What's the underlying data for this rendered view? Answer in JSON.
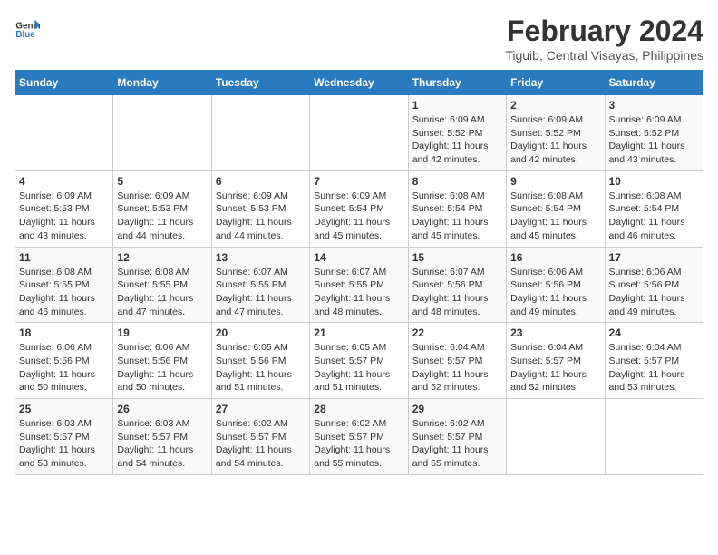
{
  "header": {
    "logo_line1": "General",
    "logo_line2": "Blue",
    "month_year": "February 2024",
    "location": "Tiguib, Central Visayas, Philippines"
  },
  "weekdays": [
    "Sunday",
    "Monday",
    "Tuesday",
    "Wednesday",
    "Thursday",
    "Friday",
    "Saturday"
  ],
  "weeks": [
    [
      {
        "day": "",
        "info": ""
      },
      {
        "day": "",
        "info": ""
      },
      {
        "day": "",
        "info": ""
      },
      {
        "day": "",
        "info": ""
      },
      {
        "day": "1",
        "info": "Sunrise: 6:09 AM\nSunset: 5:52 PM\nDaylight: 11 hours\nand 42 minutes."
      },
      {
        "day": "2",
        "info": "Sunrise: 6:09 AM\nSunset: 5:52 PM\nDaylight: 11 hours\nand 42 minutes."
      },
      {
        "day": "3",
        "info": "Sunrise: 6:09 AM\nSunset: 5:52 PM\nDaylight: 11 hours\nand 43 minutes."
      }
    ],
    [
      {
        "day": "4",
        "info": "Sunrise: 6:09 AM\nSunset: 5:53 PM\nDaylight: 11 hours\nand 43 minutes."
      },
      {
        "day": "5",
        "info": "Sunrise: 6:09 AM\nSunset: 5:53 PM\nDaylight: 11 hours\nand 44 minutes."
      },
      {
        "day": "6",
        "info": "Sunrise: 6:09 AM\nSunset: 5:53 PM\nDaylight: 11 hours\nand 44 minutes."
      },
      {
        "day": "7",
        "info": "Sunrise: 6:09 AM\nSunset: 5:54 PM\nDaylight: 11 hours\nand 45 minutes."
      },
      {
        "day": "8",
        "info": "Sunrise: 6:08 AM\nSunset: 5:54 PM\nDaylight: 11 hours\nand 45 minutes."
      },
      {
        "day": "9",
        "info": "Sunrise: 6:08 AM\nSunset: 5:54 PM\nDaylight: 11 hours\nand 45 minutes."
      },
      {
        "day": "10",
        "info": "Sunrise: 6:08 AM\nSunset: 5:54 PM\nDaylight: 11 hours\nand 46 minutes."
      }
    ],
    [
      {
        "day": "11",
        "info": "Sunrise: 6:08 AM\nSunset: 5:55 PM\nDaylight: 11 hours\nand 46 minutes."
      },
      {
        "day": "12",
        "info": "Sunrise: 6:08 AM\nSunset: 5:55 PM\nDaylight: 11 hours\nand 47 minutes."
      },
      {
        "day": "13",
        "info": "Sunrise: 6:07 AM\nSunset: 5:55 PM\nDaylight: 11 hours\nand 47 minutes."
      },
      {
        "day": "14",
        "info": "Sunrise: 6:07 AM\nSunset: 5:55 PM\nDaylight: 11 hours\nand 48 minutes."
      },
      {
        "day": "15",
        "info": "Sunrise: 6:07 AM\nSunset: 5:56 PM\nDaylight: 11 hours\nand 48 minutes."
      },
      {
        "day": "16",
        "info": "Sunrise: 6:06 AM\nSunset: 5:56 PM\nDaylight: 11 hours\nand 49 minutes."
      },
      {
        "day": "17",
        "info": "Sunrise: 6:06 AM\nSunset: 5:56 PM\nDaylight: 11 hours\nand 49 minutes."
      }
    ],
    [
      {
        "day": "18",
        "info": "Sunrise: 6:06 AM\nSunset: 5:56 PM\nDaylight: 11 hours\nand 50 minutes."
      },
      {
        "day": "19",
        "info": "Sunrise: 6:06 AM\nSunset: 5:56 PM\nDaylight: 11 hours\nand 50 minutes."
      },
      {
        "day": "20",
        "info": "Sunrise: 6:05 AM\nSunset: 5:56 PM\nDaylight: 11 hours\nand 51 minutes."
      },
      {
        "day": "21",
        "info": "Sunrise: 6:05 AM\nSunset: 5:57 PM\nDaylight: 11 hours\nand 51 minutes."
      },
      {
        "day": "22",
        "info": "Sunrise: 6:04 AM\nSunset: 5:57 PM\nDaylight: 11 hours\nand 52 minutes."
      },
      {
        "day": "23",
        "info": "Sunrise: 6:04 AM\nSunset: 5:57 PM\nDaylight: 11 hours\nand 52 minutes."
      },
      {
        "day": "24",
        "info": "Sunrise: 6:04 AM\nSunset: 5:57 PM\nDaylight: 11 hours\nand 53 minutes."
      }
    ],
    [
      {
        "day": "25",
        "info": "Sunrise: 6:03 AM\nSunset: 5:57 PM\nDaylight: 11 hours\nand 53 minutes."
      },
      {
        "day": "26",
        "info": "Sunrise: 6:03 AM\nSunset: 5:57 PM\nDaylight: 11 hours\nand 54 minutes."
      },
      {
        "day": "27",
        "info": "Sunrise: 6:02 AM\nSunset: 5:57 PM\nDaylight: 11 hours\nand 54 minutes."
      },
      {
        "day": "28",
        "info": "Sunrise: 6:02 AM\nSunset: 5:57 PM\nDaylight: 11 hours\nand 55 minutes."
      },
      {
        "day": "29",
        "info": "Sunrise: 6:02 AM\nSunset: 5:57 PM\nDaylight: 11 hours\nand 55 minutes."
      },
      {
        "day": "",
        "info": ""
      },
      {
        "day": "",
        "info": ""
      }
    ]
  ]
}
